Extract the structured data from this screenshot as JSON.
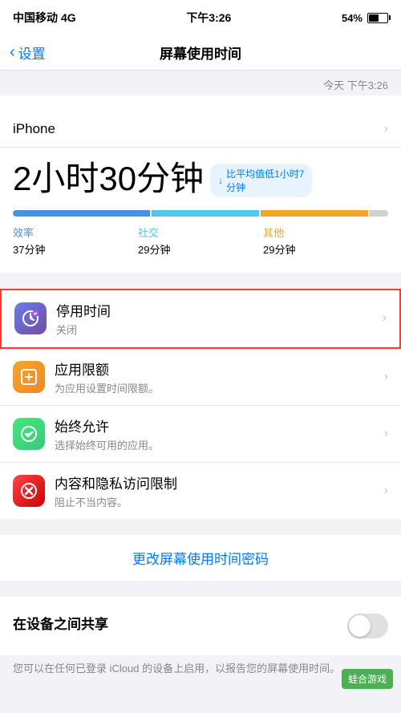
{
  "statusBar": {
    "carrier": "中国移动",
    "network": "4G",
    "time": "下午3:26",
    "battery": "54%"
  },
  "navBar": {
    "backLabel": "设置",
    "title": "屏幕使用时间"
  },
  "iphoneSection": {
    "label": "iPhone",
    "today": "今天 下午3:26"
  },
  "statsSection": {
    "label": "屏幕使用时间",
    "date": "今天 下午3:26",
    "totalTime": "2小时30分钟",
    "comparison": "↓ 比平均值低1小时7分钟",
    "categories": [
      {
        "name": "效率",
        "time": "37分钟",
        "color": "efficiency"
      },
      {
        "name": "社交",
        "time": "29分钟",
        "color": "social"
      },
      {
        "name": "其他",
        "time": "29分钟",
        "color": "other"
      }
    ]
  },
  "listItems": [
    {
      "id": "downtime",
      "title": "停用时间",
      "subtitle": "关闭",
      "iconType": "downtime",
      "iconSymbol": "⏱",
      "highlighted": true
    },
    {
      "id": "applimit",
      "title": "应用限额",
      "subtitle": "为应用设置时间限额。",
      "iconType": "applimit",
      "iconSymbol": "⏳",
      "highlighted": false
    },
    {
      "id": "always",
      "title": "始终允许",
      "subtitle": "选择始终可用的应用。",
      "iconType": "always",
      "iconSymbol": "✓",
      "highlighted": false
    },
    {
      "id": "content",
      "title": "内容和隐私访问限制",
      "subtitle": "阻止不当内容。",
      "iconType": "content",
      "iconSymbol": "⊘",
      "highlighted": false
    }
  ],
  "changePassword": {
    "label": "更改屏幕使用时间密码"
  },
  "shareSection": {
    "title": "在设备之间共享",
    "description": "您可以在任何已登录 iCloud 的设备上启用，以报告您的屏幕使用时间。"
  },
  "watermark": {
    "text": "蛙合游戏"
  }
}
